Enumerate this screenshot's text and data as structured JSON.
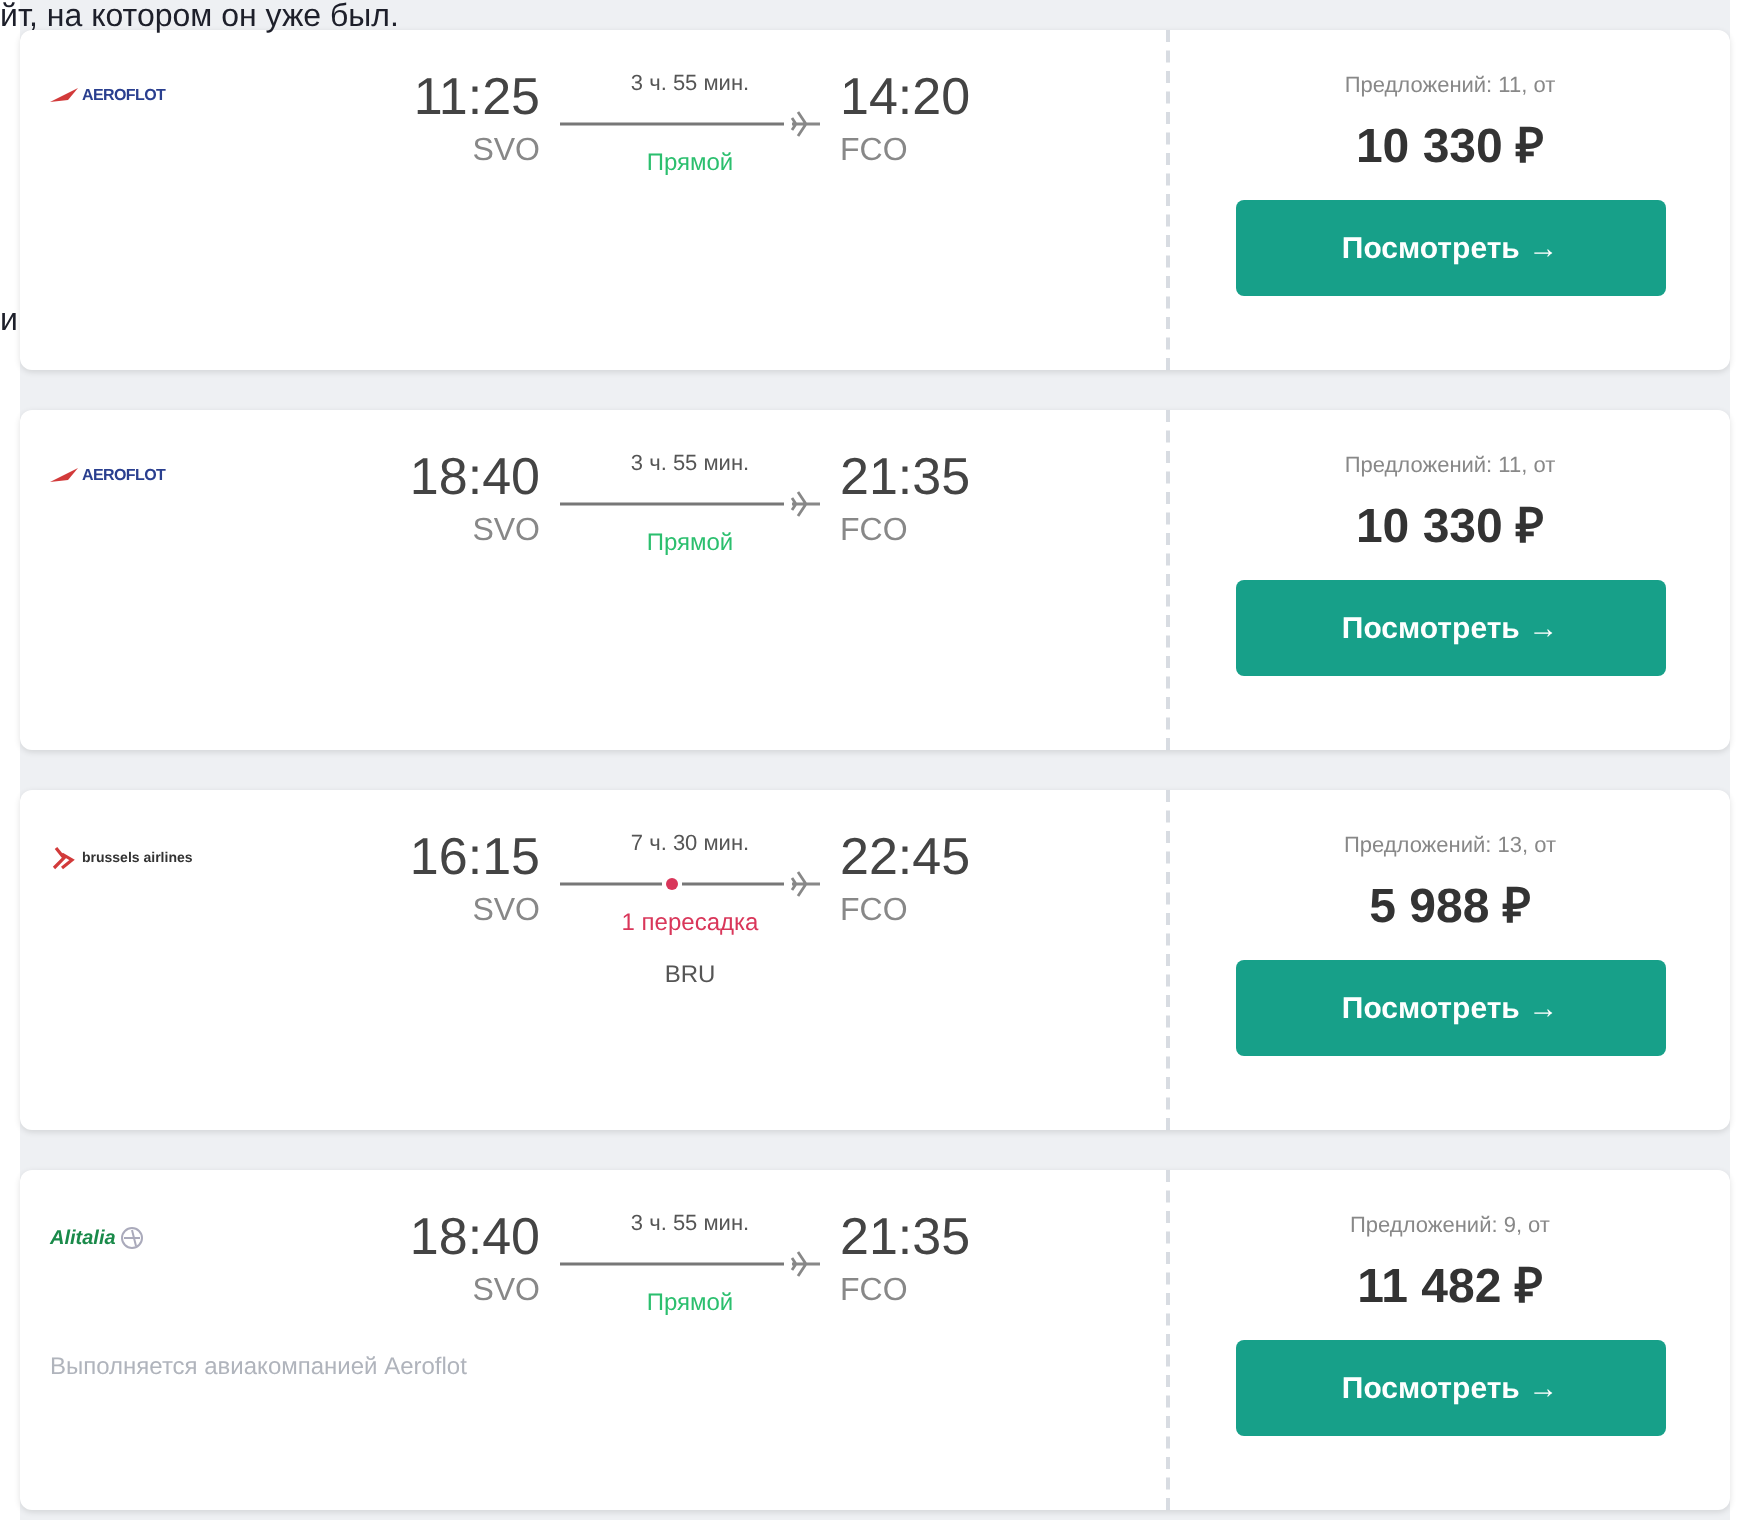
{
  "article_fragments": [
    "йт, на котором он уже был.",
    "и"
  ],
  "flights": [
    {
      "airline": {
        "kind": "aeroflot",
        "logo_text": "AEROFLOT"
      },
      "depart_time": "11:25",
      "depart_airport": "SVO",
      "duration": "3 ч. 55 мин.",
      "arrive_time": "14:20",
      "arrive_airport": "FCO",
      "kind": "direct",
      "stop_label": "Прямой",
      "offers": "Предложений: 11, от",
      "price": "10 330 ₽",
      "button": "Посмотреть →"
    },
    {
      "airline": {
        "kind": "aeroflot",
        "logo_text": "AEROFLOT"
      },
      "depart_time": "18:40",
      "depart_airport": "SVO",
      "duration": "3 ч. 55 мин.",
      "arrive_time": "21:35",
      "arrive_airport": "FCO",
      "kind": "direct",
      "stop_label": "Прямой",
      "offers": "Предложений: 11, от",
      "price": "10 330 ₽",
      "button": "Посмотреть →"
    },
    {
      "airline": {
        "kind": "brussels",
        "logo_text": "brussels airlines"
      },
      "depart_time": "16:15",
      "depart_airport": "SVO",
      "duration": "7 ч. 30 мин.",
      "arrive_time": "22:45",
      "arrive_airport": "FCO",
      "kind": "transfer",
      "stop_label": "1 пересадка",
      "stops": [
        "BRU"
      ],
      "offers": "Предложений: 13, от",
      "price": "5 988 ₽",
      "button": "Посмотреть →"
    },
    {
      "airline": {
        "kind": "alitalia",
        "logo_text": "Alitalia"
      },
      "depart_time": "18:40",
      "depart_airport": "SVO",
      "duration": "3 ч. 55 мин.",
      "arrive_time": "21:35",
      "arrive_airport": "FCO",
      "kind": "direct",
      "stop_label": "Прямой",
      "operated_by": "Выполняется авиакомпанией Aeroflot",
      "offers": "Предложений: 9, от",
      "price": "11 482 ₽",
      "button": "Посмотреть →"
    }
  ]
}
